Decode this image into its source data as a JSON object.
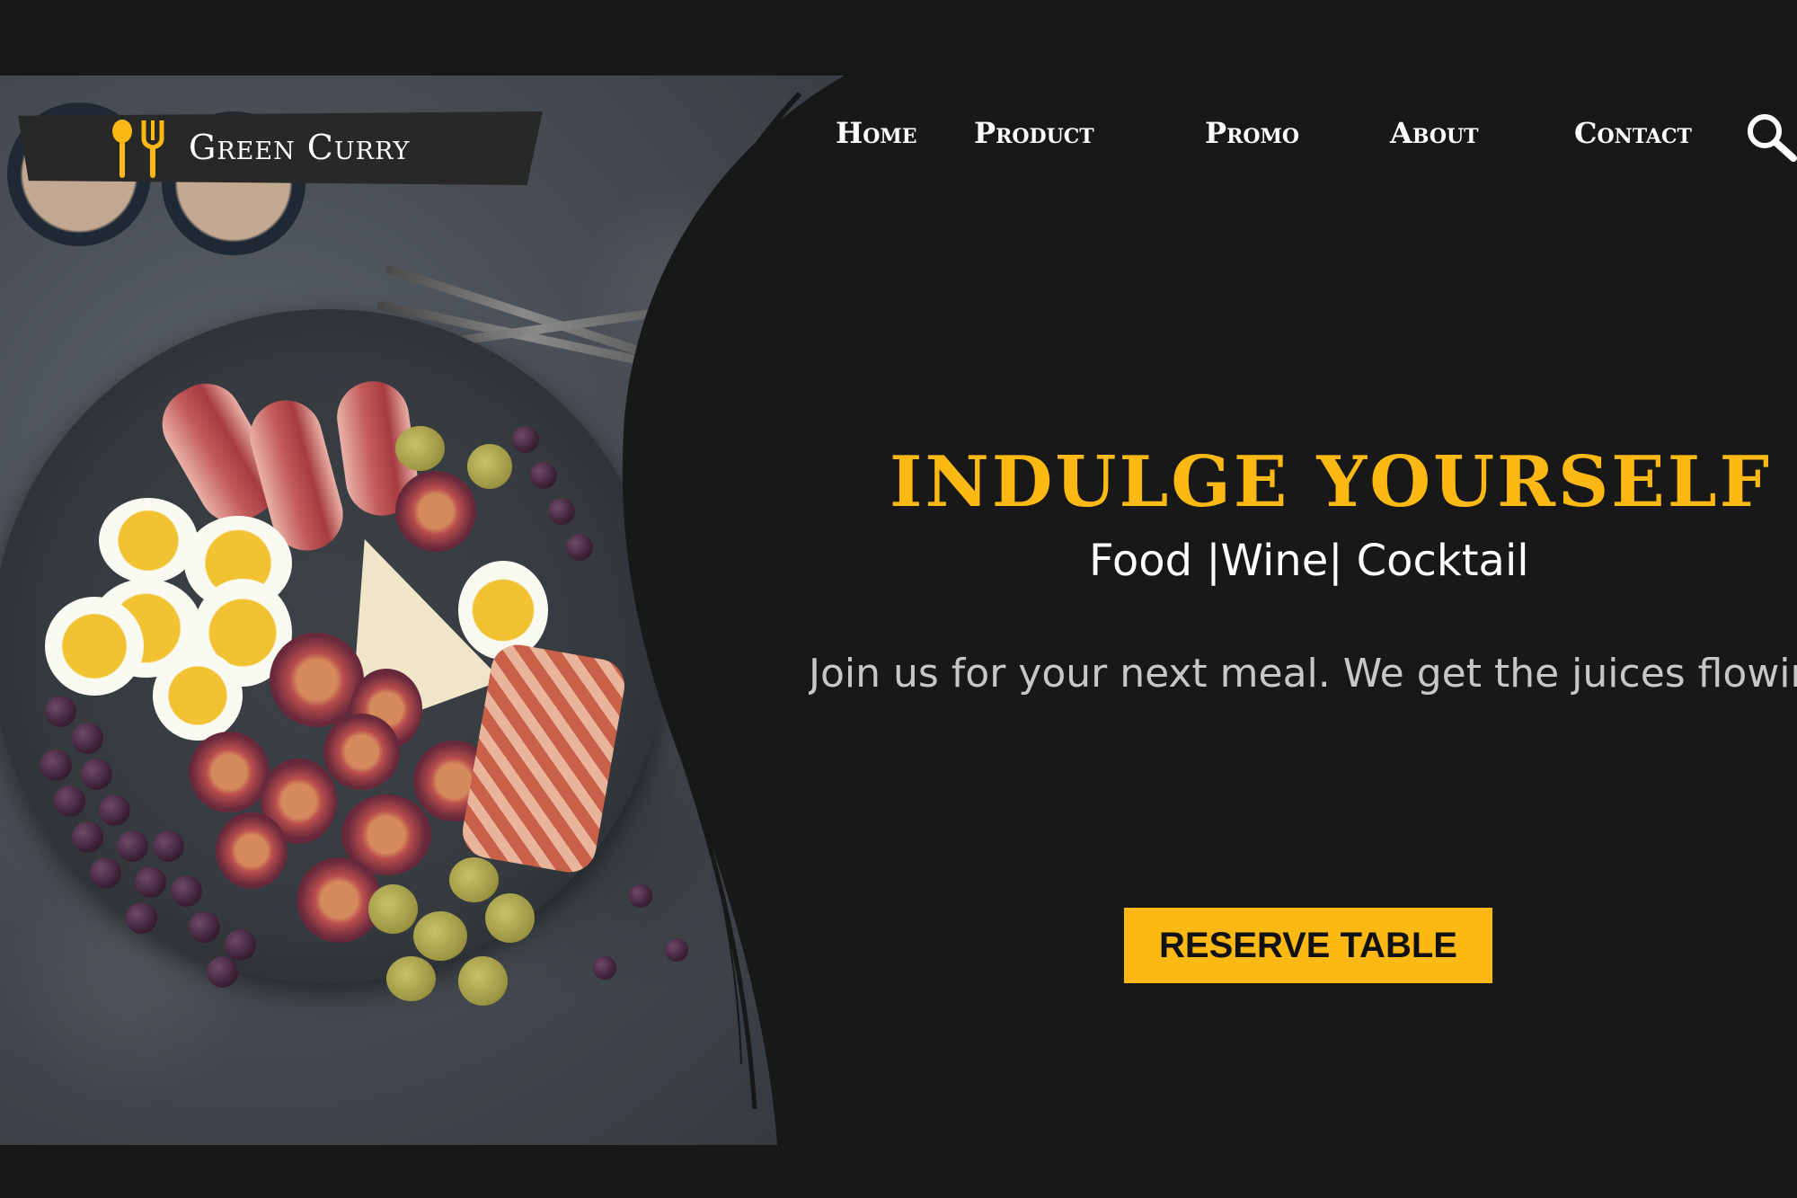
{
  "brand": {
    "name": "Green Curry",
    "icon": "fork-spoon-icon",
    "accent": "#fdb913"
  },
  "nav": {
    "items": [
      {
        "label": "Home"
      },
      {
        "label": "Product"
      },
      {
        "label": "Promo"
      },
      {
        "label": "About"
      },
      {
        "label": "Contact"
      }
    ],
    "search_icon": "search-icon"
  },
  "hero": {
    "headline": "INDULGE YOURSELF",
    "subline": "Food |Wine| Cocktail",
    "tagline": "Join us for your next meal. We get the juices flowing",
    "cta_label": "RESERVE TABLE",
    "background": "#181818"
  }
}
